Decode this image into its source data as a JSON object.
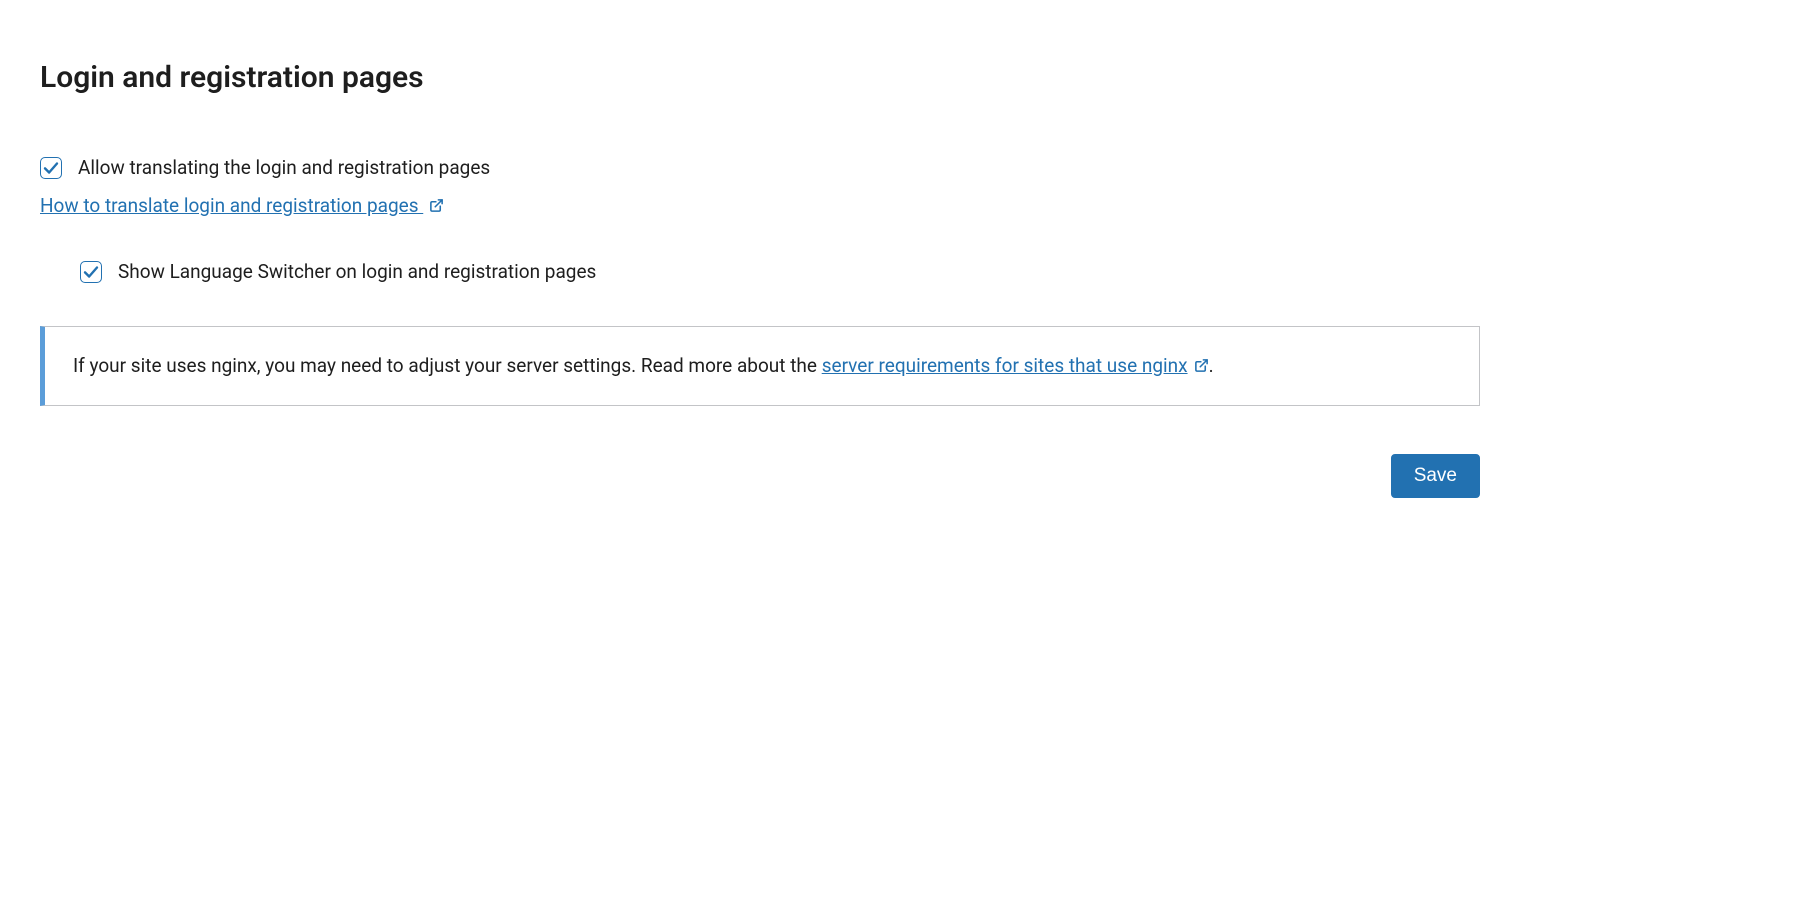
{
  "section": {
    "heading": "Login and registration pages"
  },
  "options": {
    "allow_translating": {
      "label": "Allow translating the login and registration pages",
      "checked": true
    },
    "help_link": {
      "text": "How to translate login and registration pages "
    },
    "show_switcher": {
      "label": "Show Language Switcher on login and registration pages",
      "checked": true
    }
  },
  "notice": {
    "text_before": "If your site uses nginx, you may need to adjust your server settings. Read more about the ",
    "link_text": "server requirements for sites that use nginx",
    "text_after": "."
  },
  "buttons": {
    "save": "Save"
  }
}
